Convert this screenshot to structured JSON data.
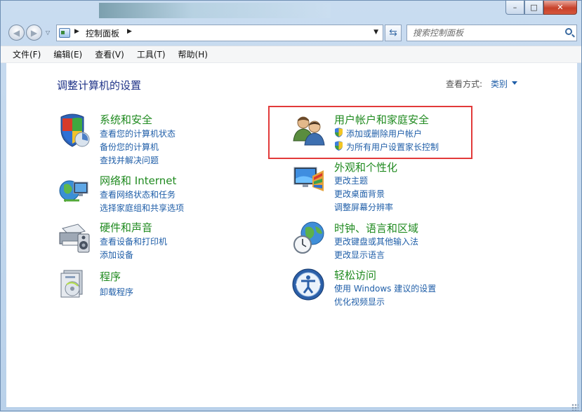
{
  "titlebar": {
    "minimize_label": "–",
    "maximize_label": "□",
    "close_label": "✕"
  },
  "navbar": {
    "back_label": "◀",
    "forward_label": "▶",
    "address": {
      "icon": "control-panel-icon",
      "path": "控制面板"
    },
    "search_placeholder": "搜索控制面板"
  },
  "menubar": {
    "items": [
      "文件(F)",
      "编辑(E)",
      "查看(V)",
      "工具(T)",
      "帮助(H)"
    ]
  },
  "content": {
    "title": "调整计算机的设置",
    "view_by_label": "查看方式:",
    "view_by_value": "类别",
    "categories": [
      {
        "title": "系统和安全",
        "icon": "system-security-icon",
        "links": [
          "查看您的计算机状态",
          "备份您的计算机",
          "查找并解决问题"
        ]
      },
      {
        "title": "网络和 Internet",
        "icon": "network-icon",
        "links": [
          "查看网络状态和任务",
          "选择家庭组和共享选项"
        ]
      },
      {
        "title": "硬件和声音",
        "icon": "hardware-sound-icon",
        "links": [
          "查看设备和打印机",
          "添加设备"
        ]
      },
      {
        "title": "程序",
        "icon": "programs-icon",
        "links": [
          "卸载程序"
        ]
      },
      {
        "title": "用户帐户和家庭安全",
        "icon": "user-accounts-icon",
        "links": [
          "添加或删除用户帐户",
          "为所有用户设置家长控制"
        ]
      },
      {
        "title": "外观和个性化",
        "icon": "appearance-icon",
        "links": [
          "更改主题",
          "更改桌面背景",
          "调整屏幕分辨率"
        ]
      },
      {
        "title": "时钟、语言和区域",
        "icon": "clock-region-icon",
        "links": [
          "更改键盘或其他输入法",
          "更改显示语言"
        ]
      },
      {
        "title": "轻松访问",
        "icon": "ease-of-access-icon",
        "links": [
          "使用 Windows 建议的设置",
          "优化视频显示"
        ]
      }
    ]
  },
  "colors": {
    "category_title": "#1f8a1f",
    "link": "#1f5ea8",
    "page_title": "#1e3287",
    "highlight_border": "#e23a3a"
  }
}
